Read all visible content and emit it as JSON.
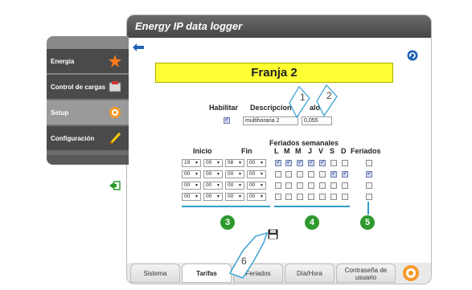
{
  "window": {
    "title": "Energy IP data logger"
  },
  "menu": {
    "items": [
      {
        "label": "Energia",
        "icon": "energy-spark-icon"
      },
      {
        "label": "Control de cargas",
        "icon": "load-control-icon"
      },
      {
        "label": "Setup",
        "icon": "setup-gear-icon"
      },
      {
        "label": "Configuración",
        "icon": "pencil-icon"
      }
    ]
  },
  "banner": {
    "title": "Franja 2"
  },
  "form": {
    "habilitar_label": "Habilitar",
    "descripcion_label": "Descripcion",
    "valor_label": "alor",
    "descripcion_value": "multihoraria 2",
    "valor_value": "0,055",
    "feriados_semanales_label": "Feriados semanales",
    "inicio_label": "Inicio",
    "fin_label": "Fin",
    "days": [
      "L",
      "M",
      "M",
      "J",
      "V",
      "S",
      "D"
    ],
    "feriados_label": "Feriados",
    "rows": [
      {
        "inicio_h": "19",
        "inicio_m": "00",
        "fin_h": "08",
        "fin_m": "00",
        "days": [
          true,
          true,
          true,
          true,
          true,
          false,
          false
        ],
        "feriados": false
      },
      {
        "inicio_h": "00",
        "inicio_m": "00",
        "fin_h": "00",
        "fin_m": "00",
        "days": [
          false,
          false,
          false,
          false,
          false,
          true,
          true
        ],
        "feriados": true
      },
      {
        "inicio_h": "00",
        "inicio_m": "00",
        "fin_h": "00",
        "fin_m": "00",
        "days": [
          false,
          false,
          false,
          false,
          false,
          false,
          false
        ],
        "feriados": false
      },
      {
        "inicio_h": "00",
        "inicio_m": "00",
        "fin_h": "00",
        "fin_m": "00",
        "days": [
          false,
          false,
          false,
          false,
          false,
          false,
          false
        ],
        "feriados": false
      }
    ]
  },
  "callouts": {
    "c1": "1",
    "c2": "2",
    "c3": "3",
    "c4": "4",
    "c5": "5",
    "c6": "6"
  },
  "tabs": [
    {
      "label": "Sistema"
    },
    {
      "label": "Tarifas"
    },
    {
      "label": "Feriados"
    },
    {
      "label": "Día/Hora"
    },
    {
      "label": "Contraseña de usuario"
    }
  ],
  "colors": {
    "banner": "#ffff33",
    "callout_blue": "#2f9dd1",
    "callout_green": "#2e9a2e"
  }
}
